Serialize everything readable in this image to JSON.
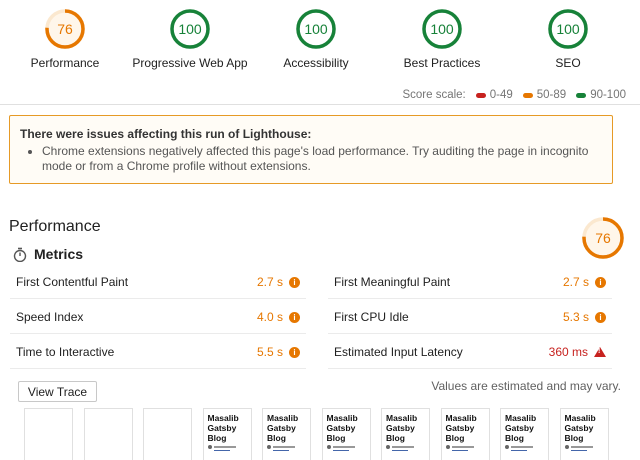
{
  "gauges": [
    {
      "score": 76,
      "label": "Performance",
      "color": "#e67700",
      "value": 0.76
    },
    {
      "score": 100,
      "label": "Progressive Web App",
      "color": "#178239",
      "value": 1.0
    },
    {
      "score": 100,
      "label": "Accessibility",
      "color": "#178239",
      "value": 1.0
    },
    {
      "score": 100,
      "label": "Best Practices",
      "color": "#178239",
      "value": 1.0
    },
    {
      "score": 100,
      "label": "SEO",
      "color": "#178239",
      "value": 1.0
    }
  ],
  "scale": {
    "label": "Score scale:",
    "items": [
      {
        "range": "0-49",
        "color": "#c7221f"
      },
      {
        "range": "50-89",
        "color": "#e67700"
      },
      {
        "range": "90-100",
        "color": "#178239"
      }
    ]
  },
  "warning": {
    "title": "There were issues affecting this run of Lighthouse:",
    "item": "Chrome extensions negatively affected this page's load performance. Try auditing the page in incognito mode or from a Chrome profile without extensions."
  },
  "performance": {
    "title": "Performance",
    "score": 76,
    "metrics_title": "Metrics",
    "metrics": [
      {
        "label": "First Contentful Paint",
        "value": "2.7 s",
        "status": "average"
      },
      {
        "label": "First Meaningful Paint",
        "value": "2.7 s",
        "status": "average"
      },
      {
        "label": "Speed Index",
        "value": "4.0 s",
        "status": "average"
      },
      {
        "label": "First CPU Idle",
        "value": "5.3 s",
        "status": "average"
      },
      {
        "label": "Time to Interactive",
        "value": "5.5 s",
        "status": "average"
      },
      {
        "label": "Estimated Input Latency",
        "value": "360 ms",
        "status": "fail"
      }
    ],
    "view_trace_label": "View Trace",
    "estimate_note": "Values are estimated and may vary."
  },
  "filmstrip": {
    "blank_count": 3,
    "frame_title": "Masalib\nGatsby\nBlog",
    "frame_count": 7
  },
  "icons": {
    "stopwatch": "stopwatch-icon",
    "info": "info-icon",
    "warning": "warning-triangle-icon"
  }
}
